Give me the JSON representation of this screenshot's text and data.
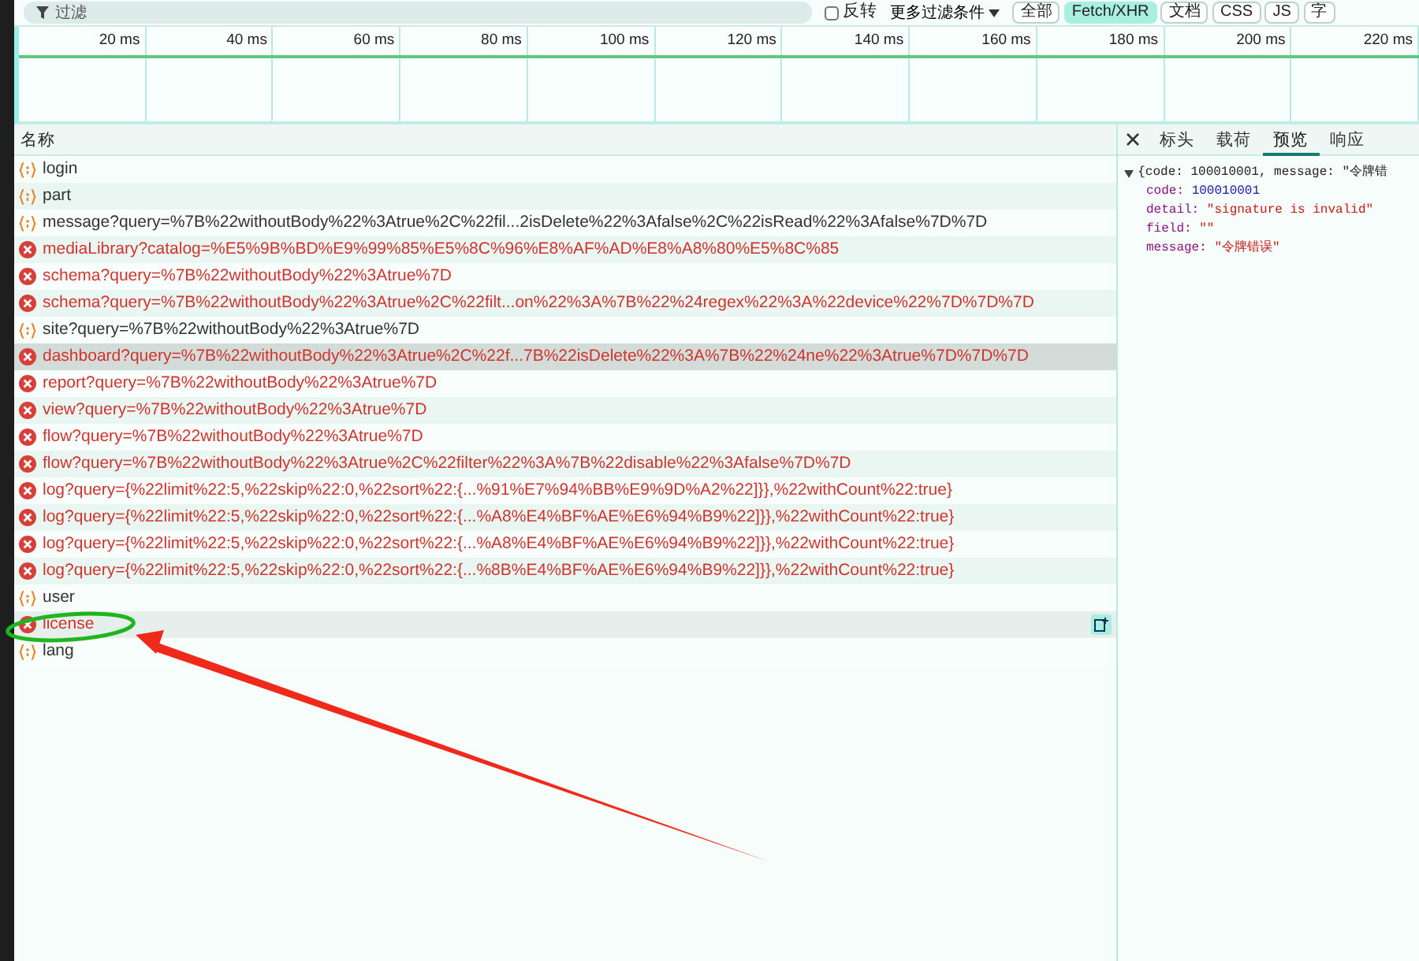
{
  "toolbar": {
    "filter": {
      "placeholder": "过滤"
    },
    "invert": {
      "label": "反转",
      "checked": false
    },
    "more_filters": "更多过滤条件",
    "type_filters": [
      {
        "label": "全部",
        "selected": false
      },
      {
        "label": "Fetch/XHR",
        "selected": true
      },
      {
        "label": "文档",
        "selected": false
      },
      {
        "label": "CSS",
        "selected": false
      },
      {
        "label": "JS",
        "selected": false
      },
      {
        "label": "字",
        "selected": false
      }
    ]
  },
  "timeline": {
    "ticks": [
      "20 ms",
      "40 ms",
      "60 ms",
      "80 ms",
      "100 ms",
      "120 ms",
      "140 ms",
      "160 ms",
      "180 ms",
      "200 ms",
      "220 ms"
    ]
  },
  "requests": {
    "column": "名称",
    "rows": [
      {
        "name": "login",
        "kind": "fetch",
        "selected": false,
        "hovered": false
      },
      {
        "name": "part",
        "kind": "fetch",
        "selected": false,
        "hovered": false
      },
      {
        "name": "message?query=%7B%22withoutBody%22%3Atrue%2C%22fil...2isDelete%22%3Afalse%2C%22isRead%22%3Afalse%7D%7D",
        "kind": "fetch",
        "selected": false,
        "hovered": false
      },
      {
        "name": "mediaLibrary?catalog=%E5%9B%BD%E9%99%85%E5%8C%96%E8%AF%AD%E8%A8%80%E5%8C%85",
        "kind": "error",
        "selected": false,
        "hovered": false
      },
      {
        "name": "schema?query=%7B%22withoutBody%22%3Atrue%7D",
        "kind": "error",
        "selected": false,
        "hovered": false
      },
      {
        "name": "schema?query=%7B%22withoutBody%22%3Atrue%2C%22filt...on%22%3A%7B%22%24regex%22%3A%22device%22%7D%7D%7D",
        "kind": "error",
        "selected": false,
        "hovered": false
      },
      {
        "name": "site?query=%7B%22withoutBody%22%3Atrue%7D",
        "kind": "fetch",
        "selected": false,
        "hovered": false
      },
      {
        "name": "dashboard?query=%7B%22withoutBody%22%3Atrue%2C%22f...7B%22isDelete%22%3A%7B%22%24ne%22%3Atrue%7D%7D%7D",
        "kind": "error",
        "selected": true,
        "hovered": false
      },
      {
        "name": "report?query=%7B%22withoutBody%22%3Atrue%7D",
        "kind": "error",
        "selected": false,
        "hovered": false
      },
      {
        "name": "view?query=%7B%22withoutBody%22%3Atrue%7D",
        "kind": "error",
        "selected": false,
        "hovered": false
      },
      {
        "name": "flow?query=%7B%22withoutBody%22%3Atrue%7D",
        "kind": "error",
        "selected": false,
        "hovered": false
      },
      {
        "name": "flow?query=%7B%22withoutBody%22%3Atrue%2C%22filter%22%3A%7B%22disable%22%3Afalse%7D%7D",
        "kind": "error",
        "selected": false,
        "hovered": false
      },
      {
        "name": "log?query={%22limit%22:5,%22skip%22:0,%22sort%22:{...%91%E7%94%BB%E9%9D%A2%22]}},%22withCount%22:true}",
        "kind": "error",
        "selected": false,
        "hovered": false
      },
      {
        "name": "log?query={%22limit%22:5,%22skip%22:0,%22sort%22:{...%A8%E4%BF%AE%E6%94%B9%22]}},%22withCount%22:true}",
        "kind": "error",
        "selected": false,
        "hovered": false
      },
      {
        "name": "log?query={%22limit%22:5,%22skip%22:0,%22sort%22:{...%A8%E4%BF%AE%E6%94%B9%22]}},%22withCount%22:true}",
        "kind": "error",
        "selected": false,
        "hovered": false
      },
      {
        "name": "log?query={%22limit%22:5,%22skip%22:0,%22sort%22:{...%8B%E4%BF%AE%E6%94%B9%22]}},%22withCount%22:true}",
        "kind": "error",
        "selected": false,
        "hovered": false
      },
      {
        "name": "user",
        "kind": "fetch",
        "selected": false,
        "hovered": false
      },
      {
        "name": "license",
        "kind": "error",
        "selected": false,
        "hovered": true
      },
      {
        "name": "lang",
        "kind": "fetch",
        "selected": false,
        "hovered": false
      }
    ]
  },
  "detail": {
    "tabs": [
      {
        "label": "标头",
        "selected": false
      },
      {
        "label": "载荷",
        "selected": false
      },
      {
        "label": "预览",
        "selected": true
      },
      {
        "label": "响应",
        "selected": false
      }
    ],
    "preview": {
      "summary": "{code: 100010001, message: \"令牌错",
      "fields": [
        {
          "key": "code:",
          "value": "100010001",
          "kind": "number"
        },
        {
          "key": "detail:",
          "value": "\"signature is invalid\"",
          "kind": "string"
        },
        {
          "key": "field:",
          "value": "\"\"",
          "kind": "string"
        },
        {
          "key": "message:",
          "value": "\"令牌错误\"",
          "kind": "string"
        }
      ]
    }
  }
}
